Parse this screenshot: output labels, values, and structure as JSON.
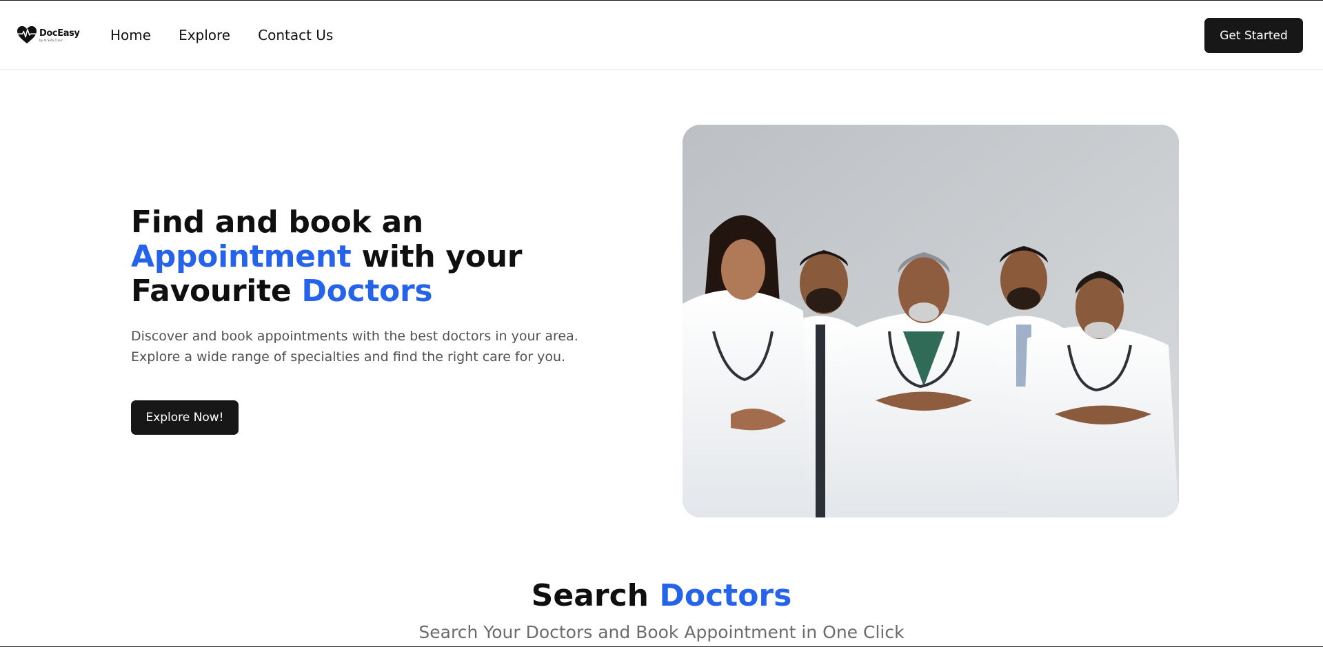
{
  "brand": {
    "name": "DocEasy",
    "tagline": "by Al Safa Clinic",
    "accent_color": "#2563eb",
    "button_color": "#171717",
    "logo_icon": "heart-pulse-icon"
  },
  "nav": {
    "links": [
      {
        "label": "Home"
      },
      {
        "label": "Explore"
      },
      {
        "label": "Contact Us"
      }
    ],
    "cta_label": "Get Started"
  },
  "hero": {
    "title_line1": "Find and book an",
    "title_line2_highlight": "Appointment",
    "title_line2_rest": " with your",
    "title_line3_start": "Favourite ",
    "title_line3_highlight": "Doctors",
    "description_line1": "Discover and book appointments with the best doctors in your area.",
    "description_line2": "Explore a wide range of specialties and find the right care for you.",
    "button_label": "Explore Now!",
    "image_subject": "group of five doctors in white coats with stethoscopes"
  },
  "search": {
    "title_start": "Search ",
    "title_highlight": "Doctors",
    "subtitle": "Search Your Doctors and Book Appointment in One Click"
  }
}
